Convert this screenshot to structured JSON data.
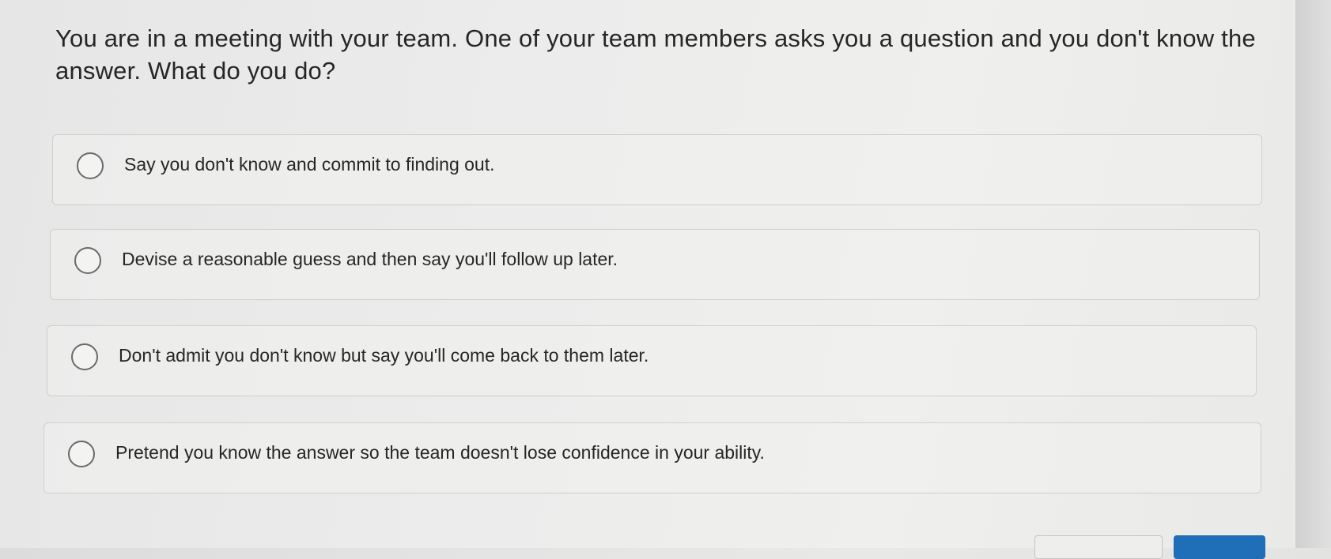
{
  "question": {
    "text": "You are in a meeting with your team. One of your team members asks you a question and you don't know the answer. What do you do?"
  },
  "options": [
    {
      "label": "Say you don't know and commit to finding out.",
      "selected": false
    },
    {
      "label": "Devise a reasonable guess and then say you'll follow up later.",
      "selected": false
    },
    {
      "label": "Don't admit you don't know but say you'll come back to them later.",
      "selected": false
    },
    {
      "label": "Pretend you know the answer so the team doesn't lose confidence in your ability.",
      "selected": false
    }
  ],
  "colors": {
    "primary_button": "#1f6fb8",
    "text": "#262626",
    "border": "#cfcfcf"
  }
}
